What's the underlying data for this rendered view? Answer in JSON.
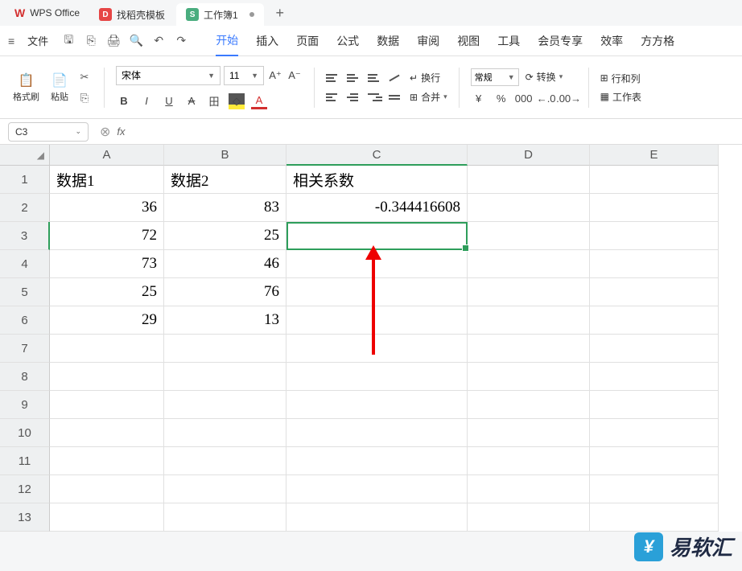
{
  "titlebar": {
    "app_name": "WPS Office",
    "tabs": [
      {
        "icon": "D",
        "label": "找稻壳模板"
      },
      {
        "icon": "S",
        "label": "工作簿1"
      }
    ]
  },
  "menubar": {
    "file": "文件",
    "tabs": [
      "开始",
      "插入",
      "页面",
      "公式",
      "数据",
      "审阅",
      "视图",
      "工具",
      "会员专享",
      "效率",
      "方方格"
    ]
  },
  "toolbar": {
    "format_brush": "格式刷",
    "paste": "粘贴",
    "font_name": "宋体",
    "font_size": "11",
    "wrap": "换行",
    "merge": "合并",
    "number_format": "常规",
    "convert": "转换",
    "rows_cols": "行和列",
    "worksheet": "工作表"
  },
  "formula_bar": {
    "name_box": "C3",
    "formula": ""
  },
  "sheet": {
    "col_headers": [
      "A",
      "B",
      "C",
      "D",
      "E"
    ],
    "row_headers": [
      "1",
      "2",
      "3",
      "4",
      "5",
      "6",
      "7",
      "8",
      "9",
      "10",
      "11",
      "12",
      "13"
    ],
    "headers": {
      "A": "数据1",
      "B": "数据2",
      "C": "相关系数"
    },
    "data": [
      {
        "A": "36",
        "B": "83",
        "C": "-0.344416608"
      },
      {
        "A": "72",
        "B": "25"
      },
      {
        "A": "73",
        "B": "46"
      },
      {
        "A": "25",
        "B": "76"
      },
      {
        "A": "29",
        "B": "13"
      }
    ],
    "selected": "C3"
  },
  "watermark": "易软汇"
}
